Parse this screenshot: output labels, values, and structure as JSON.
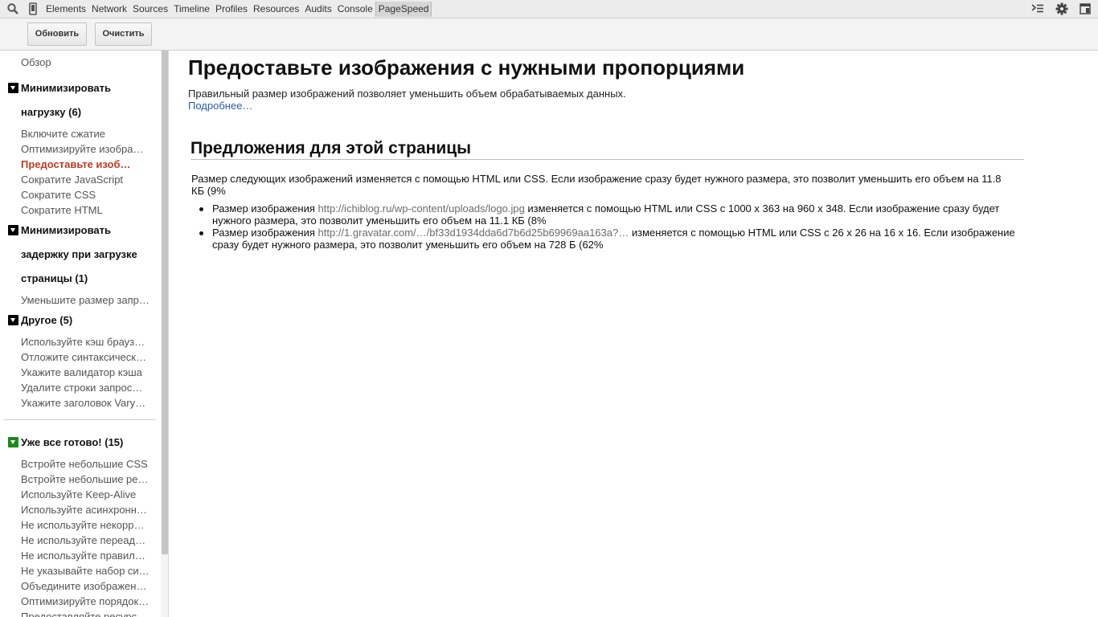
{
  "tabbar": {
    "tabs": [
      "Elements",
      "Network",
      "Sources",
      "Timeline",
      "Profiles",
      "Resources",
      "Audits",
      "Console",
      "PageSpeed"
    ],
    "selected": "PageSpeed"
  },
  "toolbar": {
    "refresh_label": "Обновить",
    "clear_label": "Очистить"
  },
  "sidebar": {
    "overview": "Обзор",
    "group1": {
      "title_lines": [
        "Минимизировать",
        "нагрузку (6)"
      ],
      "items": [
        "Включите сжатие",
        "Оптимизируйте изобра…",
        "Предоставьте изоб…",
        "Сократите JavaScript",
        "Сократите CSS",
        "Сократите HTML"
      ],
      "active_index": 2
    },
    "group2": {
      "title_lines": [
        "Минимизировать",
        "задержку при загрузке",
        "страницы (1)"
      ],
      "items": [
        "Уменьшите размер запр…"
      ]
    },
    "group3": {
      "title": "Другое (5)",
      "items": [
        "Используйте кэш брауз…",
        "Отложите синтаксическ…",
        "Укажите валидатор кэша",
        "Удалите строки запрос…",
        "Укажите заголовок Vary…"
      ]
    },
    "group4": {
      "title": "Уже все готово! (15)",
      "items": [
        "Встройте небольшие CSS",
        "Встройте небольшие ре…",
        "Используйте Keep-Alive",
        "Используйте асинхронн…",
        "Не используйте некорр…",
        "Не используйте переад…",
        "Не используйте правил…",
        "Не указывайте набор си…",
        "Объедините изображен…",
        "Оптимизируйте порядок…",
        "Предоставляйте ресурс…"
      ]
    }
  },
  "main": {
    "title": "Предоставьте изображения с нужными пропорциями",
    "intro": "Правильный размер изображений позволяет уменьшить объем обрабатываемых данных.",
    "more_link": "Подробнее…",
    "section_title": "Предложения для этой страницы",
    "summary": "Размер следующих изображений изменяется с помощью HTML или CSS. Если изображение сразу будет нужного размера, это позволит уменьшить его объем на 11.8 КБ (9%",
    "bullets": [
      {
        "prefix": "Размер изображения ",
        "url": "http://ichiblog.ru/wp-content/uploads/logo.jpg",
        "suffix": " изменяется с помощью HTML или CSS с 1000 x 363 на 960 x 348. Если изображение сразу будет нужного размера, это позволит уменьшить его объем на 11.1 КБ (8%"
      },
      {
        "prefix": "Размер изображения ",
        "url": "http://1.gravatar.com/…/bf33d1934dda6d7b6d25b69969aa163a?…",
        "suffix": " изменяется с помощью HTML или CSS с 26 x 26 на 16 x 16. Если изображение сразу будет нужного размера, это позволит уменьшить его объем на 728 Б (62%"
      }
    ]
  },
  "colors": {
    "active_item": "#c23b22",
    "link": "#2a5db0",
    "ready_group": "#1a8a1a"
  }
}
